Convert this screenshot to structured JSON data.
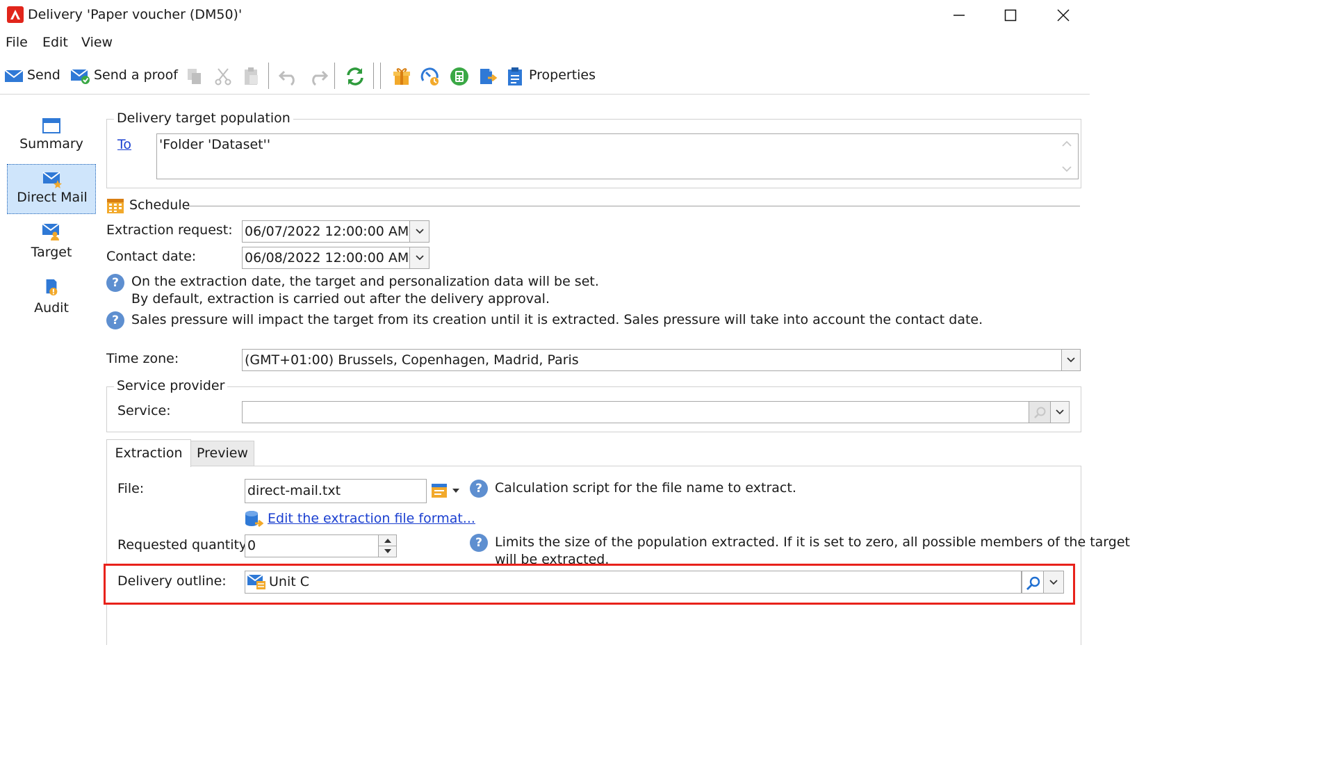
{
  "window": {
    "title": "Delivery 'Paper voucher (DM50)'",
    "minimize_icon": "minimize-icon",
    "maximize_icon": "maximize-icon",
    "close_icon": "close-icon"
  },
  "menu": [
    "File",
    "Edit",
    "View"
  ],
  "toolbar": {
    "send_label": "Send",
    "send_proof_label": "Send a proof",
    "properties_label": "Properties"
  },
  "nav": {
    "items": [
      {
        "label": "Summary",
        "icon": "summary-icon"
      },
      {
        "label": "Direct Mail",
        "icon": "direct-mail-icon",
        "selected": true
      },
      {
        "label": "Target",
        "icon": "target-icon"
      },
      {
        "label": "Audit",
        "icon": "audit-icon"
      }
    ]
  },
  "target_population": {
    "group_title": "Delivery target population",
    "to_link": "To",
    "value": "'Folder 'Dataset''"
  },
  "schedule": {
    "title": "Schedule",
    "extraction_request_label": "Extraction request:",
    "extraction_request_value": "06/07/2022 12:00:00 AM",
    "contact_date_label": "Contact date:",
    "contact_date_value": "06/08/2022 12:00:00 AM",
    "help1_line1": "On the extraction date, the target and personalization data will be set.",
    "help1_line2": "By default, extraction is carried out after the delivery approval.",
    "help2": "Sales pressure will impact the target from its creation until it is extracted. Sales pressure will take into account the contact date."
  },
  "timezone": {
    "label": "Time zone:",
    "value": "(GMT+01:00) Brussels, Copenhagen, Madrid, Paris"
  },
  "service_provider": {
    "group_title": "Service provider",
    "service_label": "Service:",
    "service_value": ""
  },
  "tabs": [
    "Extraction",
    "Preview"
  ],
  "extraction": {
    "file_label": "File:",
    "file_value": "direct-mail.txt",
    "file_help": "Calculation script for the file name to extract.",
    "edit_format_link": "Edit the extraction file format...",
    "quantity_label": "Requested quantity:",
    "quantity_value": "0",
    "quantity_help_line1": "Limits the size of the population extracted. If it is set to zero, all possible members of the target",
    "quantity_help_line2": "will be extracted.",
    "outline_label": "Delivery outline:",
    "outline_value": "Unit C"
  },
  "colors": {
    "highlight": "#e8221b",
    "selected_nav": "#cfe5fb",
    "link": "#1a3fd0",
    "help_icon": "#5e8fd0"
  }
}
